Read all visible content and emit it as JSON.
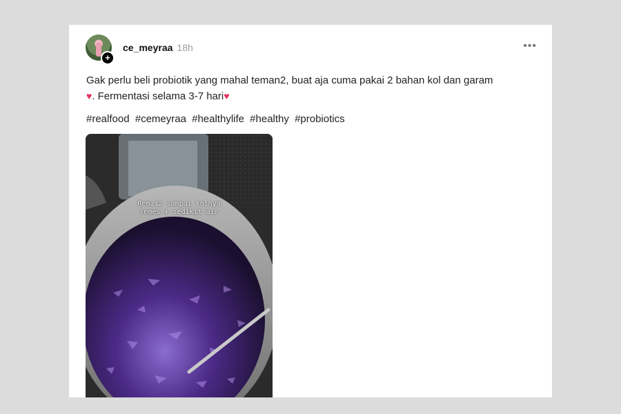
{
  "post": {
    "username": "ce_meyraa",
    "time": "18h",
    "text_line1": "Gak perlu beli probiotik yang mahal teman2, buat aja cuma pakai 2 bahan kol dan garam",
    "text_line2": ". Fermentasi selama 3-7 hari",
    "heart_icon": "heart-icon",
    "hashtags": [
      "#realfood",
      "#cemeyraa",
      "#healthylife",
      "#healthy",
      "#probiotics"
    ],
    "media_caption_line1": "Remas2 sampai kolnya",
    "media_caption_line2": "lemes + sedikit air"
  },
  "colors": {
    "background": "#dcdcdc",
    "card": "#ffffff",
    "heart": "#e0315c"
  }
}
